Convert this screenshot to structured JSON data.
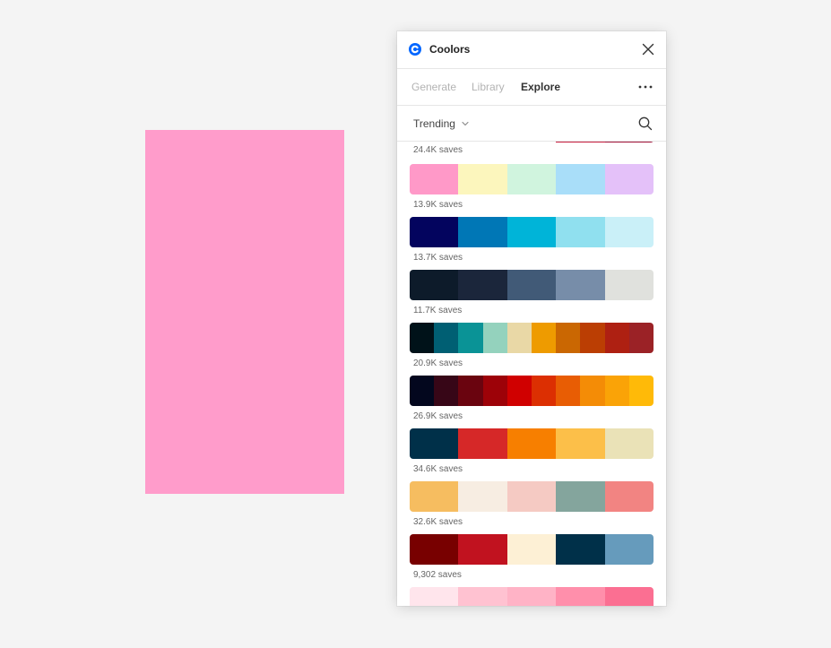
{
  "canvas": {
    "fill_color": "#ff9ccb"
  },
  "panel": {
    "title": "Coolors",
    "logo_color": "#0066ff",
    "tabs": [
      {
        "label": "Generate",
        "active": false
      },
      {
        "label": "Library",
        "active": false
      },
      {
        "label": "Explore",
        "active": true
      }
    ],
    "filter": {
      "selected": "Trending"
    },
    "icons": {
      "logo": "coolors-logo-icon",
      "close": "close-icon",
      "more": "more-horizontal-icon",
      "chevron": "chevron-down-icon",
      "search": "search-icon"
    }
  },
  "palettes": [
    {
      "saves": "24.4K saves",
      "colors": [
        "#ffffff",
        "#ffffff",
        "#ffffff",
        "#c81e40",
        "#a3153a"
      ]
    },
    {
      "saves": "13.9K saves",
      "colors": [
        "#ff99c8",
        "#fcf6bd",
        "#d0f4de",
        "#a9def9",
        "#e4c1f9"
      ]
    },
    {
      "saves": "13.7K saves",
      "colors": [
        "#03045e",
        "#0077b6",
        "#00b4d8",
        "#90e0ef",
        "#caf0f8"
      ]
    },
    {
      "saves": "11.7K saves",
      "colors": [
        "#0d1b2a",
        "#1b263b",
        "#415a77",
        "#778da9",
        "#e0e1dd"
      ]
    },
    {
      "saves": "20.9K saves",
      "colors": [
        "#001219",
        "#005f73",
        "#0a9396",
        "#94d2bd",
        "#e9d8a6",
        "#ee9b00",
        "#ca6702",
        "#bb3e03",
        "#ae2012",
        "#9b2226"
      ]
    },
    {
      "saves": "26.9K saves",
      "colors": [
        "#03071e",
        "#370617",
        "#6a040f",
        "#9d0208",
        "#d00000",
        "#dc2f02",
        "#e85d04",
        "#f48c06",
        "#faa307",
        "#ffba08"
      ]
    },
    {
      "saves": "34.6K saves",
      "colors": [
        "#003049",
        "#d62828",
        "#f77f00",
        "#fcbf49",
        "#eae2b7"
      ]
    },
    {
      "saves": "32.6K saves",
      "colors": [
        "#f6bd60",
        "#f7ede2",
        "#f5cac3",
        "#84a59d",
        "#f28482"
      ]
    },
    {
      "saves": "9,302 saves",
      "colors": [
        "#780000",
        "#c1121f",
        "#fdf0d5",
        "#003049",
        "#669bbc"
      ]
    },
    {
      "saves": "",
      "colors": [
        "#ffe5ec",
        "#ffc2d1",
        "#ffb3c6",
        "#ff8fab",
        "#fb6f92"
      ]
    }
  ]
}
